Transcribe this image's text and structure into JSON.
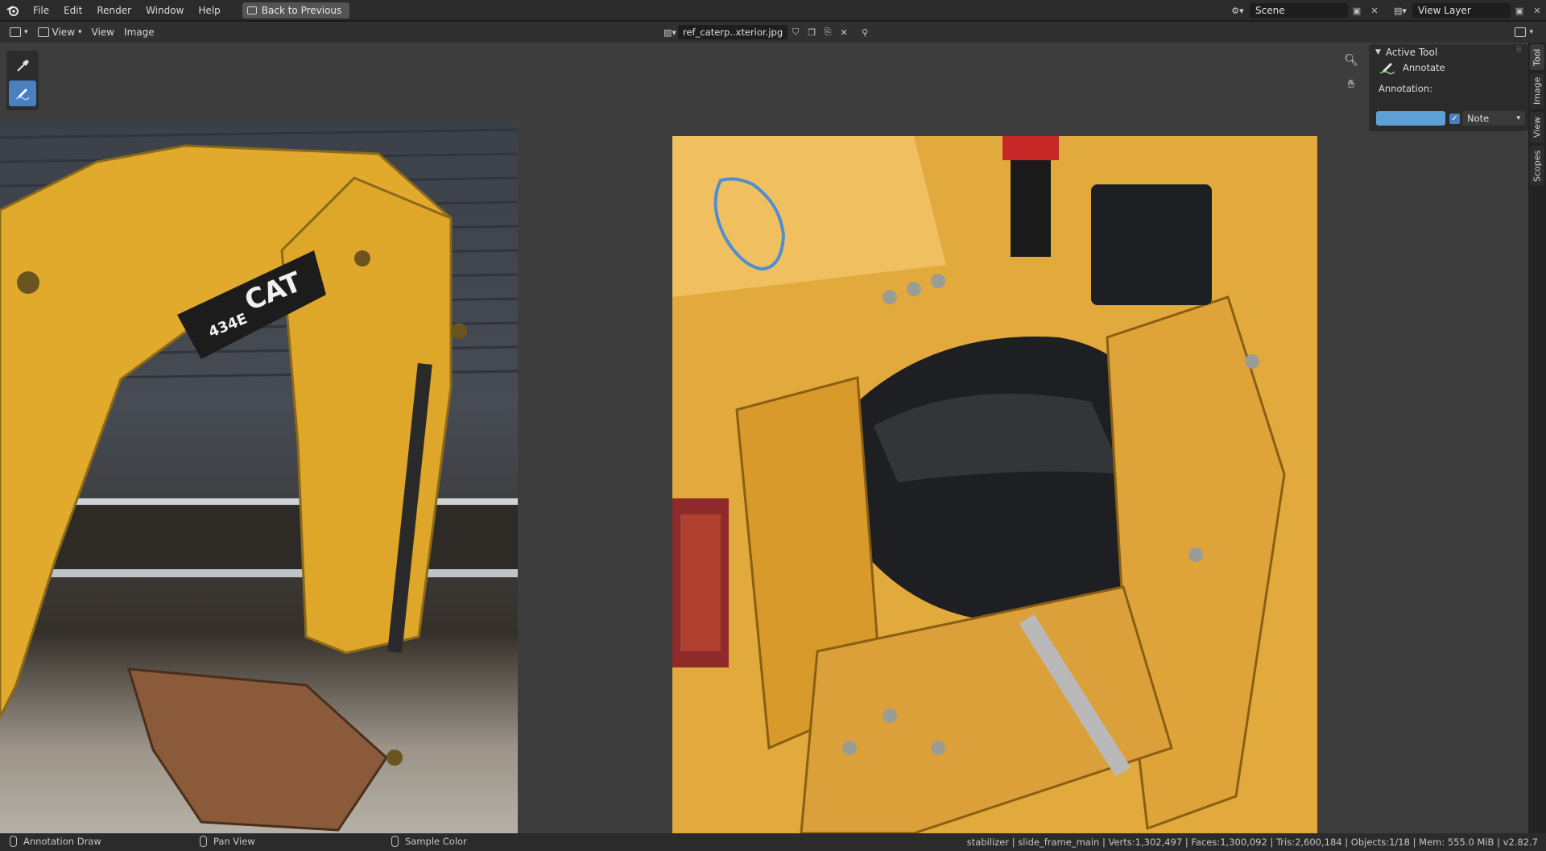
{
  "menu": {
    "items": [
      "File",
      "Edit",
      "Render",
      "Window",
      "Help"
    ],
    "back_button": "Back to Previous"
  },
  "top_right": {
    "scene": "Scene",
    "view_layer": "View Layer"
  },
  "editor_header": {
    "view_dropdown": "View",
    "menu_view": "View",
    "menu_image": "Image",
    "image_name": "ref_caterp..xterior.jpg"
  },
  "side_panel": {
    "title": "Active Tool",
    "tool_name": "Annotate",
    "annotation_label": "Annotation:",
    "annotation_color": "#5e9fd8",
    "layer": "Note",
    "tabs": [
      "Tool",
      "Image",
      "View",
      "Scopes"
    ]
  },
  "status": {
    "left_action": "Annotation Draw",
    "middle_action": "Pan View",
    "right_action": "Sample Color",
    "info": "stabilizer | slide_frame_main | Verts:1,302,497 | Faces:1,300,092 | Tris:2,600,184 | Objects:1/18 | Mem: 555.0 MiB | v2.82.7"
  },
  "photo": {
    "logo_text": "CAT",
    "model_text": "434E"
  }
}
